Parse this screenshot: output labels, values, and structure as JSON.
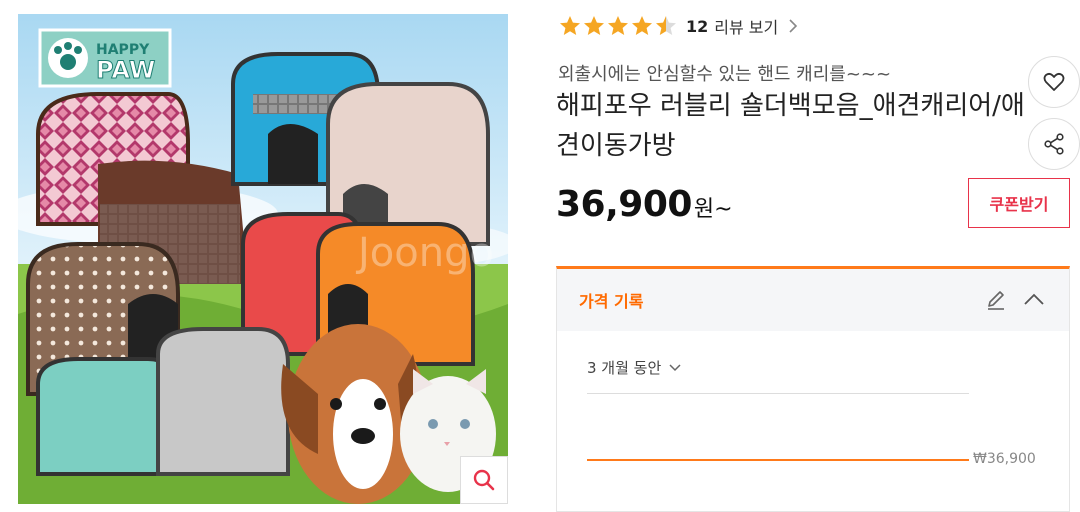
{
  "product": {
    "image_brand": "HAPPY PAW",
    "image_watermark": "Joongo"
  },
  "rating": {
    "stars": 4.5,
    "count": "12",
    "label": "리뷰 보기"
  },
  "subtitle": "외출시에는 안심할수 있는 핸드 캐리를~~~",
  "title": "해피포우 러블리 숄더백모음_애견캐리어/애견이동가방",
  "price": {
    "amount": "36,900",
    "unit": "원~"
  },
  "coupon_label": "쿠폰받기",
  "price_history": {
    "title": "가격 기록",
    "period": "3 개월 동안",
    "current_price": "₩36,900"
  },
  "colors": {
    "accent_orange": "#ff7a1a",
    "coupon_red": "#e8334a",
    "star": "#f5a623"
  },
  "icons": [
    "search-icon",
    "heart-icon",
    "share-icon",
    "edit-icon",
    "chevron-up-icon",
    "chevron-down-icon",
    "chevron-right-icon",
    "star-icon"
  ]
}
